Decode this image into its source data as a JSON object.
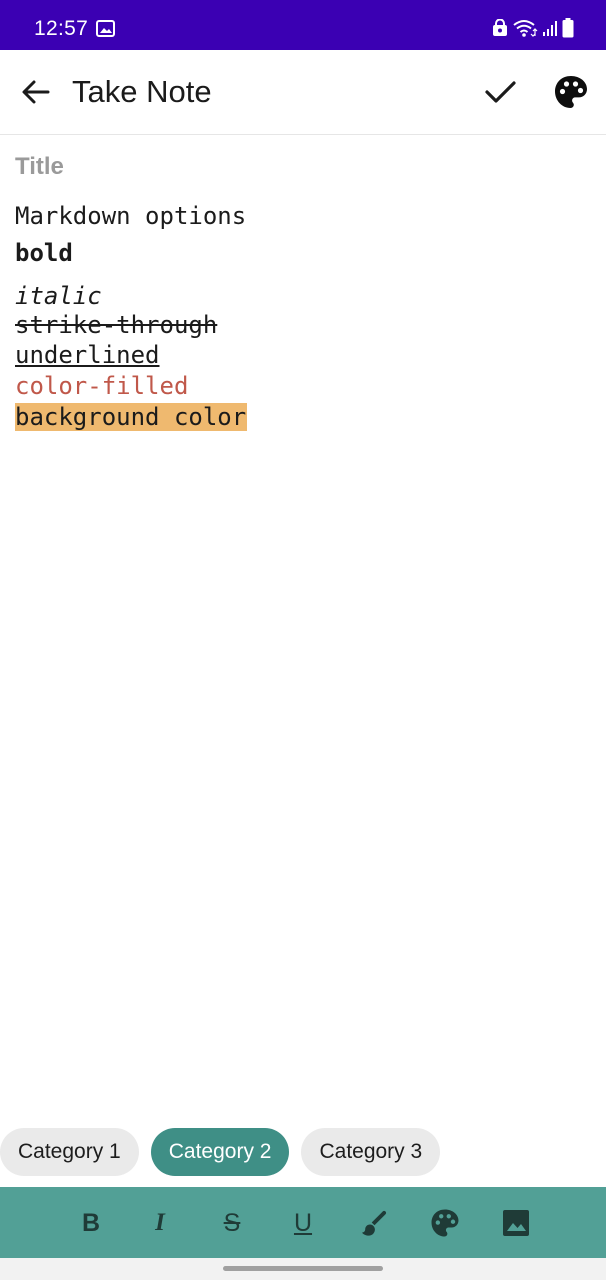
{
  "status_bar": {
    "time": "12:57",
    "icons": [
      "gallery-icon",
      "lock-icon",
      "wifi-icon",
      "signal-icon",
      "battery-icon"
    ],
    "background": "#3b00b3"
  },
  "app_bar": {
    "back_icon": "arrow-back-icon",
    "title": "Take Note",
    "save_icon": "check-icon",
    "color_icon": "palette-icon"
  },
  "note": {
    "title_placeholder": "Title",
    "title_value": "",
    "lines": {
      "markdown": "Markdown options",
      "bold": "bold",
      "italic": "italic",
      "strike": "strike-through",
      "underline": "underlined",
      "color": "color-filled",
      "background": "background color"
    },
    "text_color_sample": "#c0584a",
    "background_color_sample": "#efb96f"
  },
  "categories": {
    "items": [
      {
        "label": "Category 1",
        "selected": false
      },
      {
        "label": "Category 2",
        "selected": true
      },
      {
        "label": "Category 3",
        "selected": false
      }
    ],
    "selected_color": "#3f8f86"
  },
  "format_toolbar": {
    "background": "#52a096",
    "buttons": {
      "bold": "B",
      "italic": "I",
      "strike": "S",
      "underline": "U"
    },
    "icons": [
      "format-bold-icon",
      "format-italic-icon",
      "format-strikethrough-icon",
      "format-underline-icon",
      "brush-icon",
      "palette-icon",
      "image-icon"
    ]
  }
}
